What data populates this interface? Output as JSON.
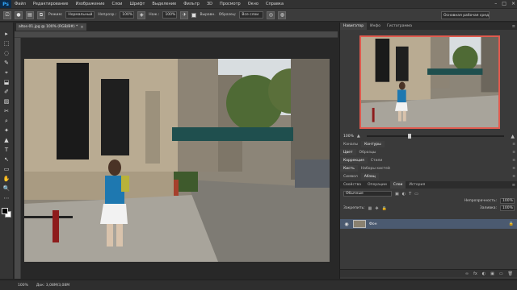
{
  "app": {
    "logo": "Ps"
  },
  "menu": [
    "Файл",
    "Редактирование",
    "Изображение",
    "Слои",
    "Шрифт",
    "Выделение",
    "Фильтр",
    "3D",
    "Просмотр",
    "Окно",
    "Справка"
  ],
  "window_controls": [
    "–",
    "□",
    "×"
  ],
  "options": {
    "mode_label": "Режим:",
    "mode_value": "Нормальный",
    "opacity_label": "Непрозр.:",
    "opacity_value": "100%",
    "pressure_label": "Наж.:",
    "pressure_value": "100%",
    "align_label": "Выравн.",
    "sample_label": "Образец:",
    "sample_value": "Все слои",
    "workspace": "Основная рабочая среда"
  },
  "document": {
    "tab_title": "altos-01.jpg @ 100% (RGB/8#) *",
    "close": "×"
  },
  "tools": [
    "▸",
    "⬚",
    "◌",
    "✎",
    "⌖",
    "⬓",
    "✐",
    "▨",
    "✂",
    "⌕",
    "✦",
    "▲",
    "T",
    "↖",
    "▭",
    "✋",
    "🔍",
    "⋯"
  ],
  "status": {
    "zoom": "100%",
    "doc_size": "Док: 3,08М/3,08М"
  },
  "panels": {
    "navigator_tabs": [
      "Навигатор",
      "Инфо",
      "Гистограмма"
    ],
    "nav_zoom": "100%",
    "adjust_tabs_1": [
      "Каналы",
      "Контуры"
    ],
    "adjust_tabs_2": [
      "Цвет",
      "Образцы"
    ],
    "adjust_tabs_3": [
      "Коррекция",
      "Стили"
    ],
    "adjust_tabs_4": [
      "Кисть",
      "Наборы кистей"
    ],
    "adjust_tabs_5": [
      "Символ",
      "Абзац"
    ],
    "layers_tabs": [
      "Свойства",
      "Операции",
      "Слои",
      "История"
    ],
    "kind_label": "Обычные",
    "opacity_label": "Непрозрачность:",
    "opacity_value": "100%",
    "lock_label": "Закрепить:",
    "fill_label": "Заливка:",
    "fill_value": "100%",
    "layer_name": "Фон",
    "footer_icons": [
      "∞",
      "fx",
      "◐",
      "▣",
      "▭",
      "🗑"
    ]
  },
  "colors": {
    "accent_highlight": "#e05a4e",
    "layer_selected": "#4b5a70"
  }
}
